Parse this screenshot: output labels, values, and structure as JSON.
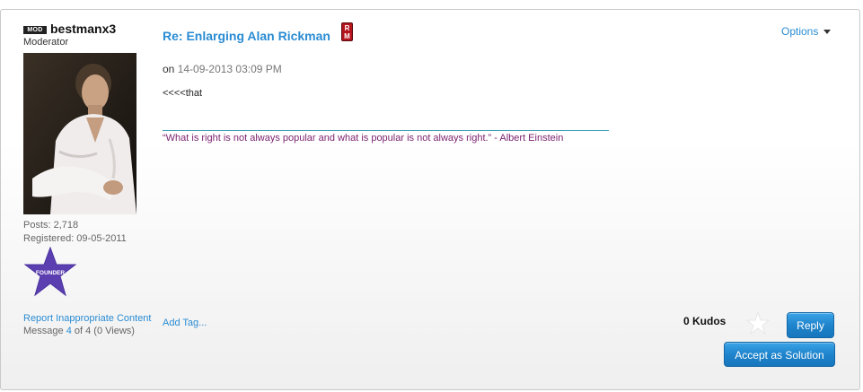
{
  "author": {
    "badge": "MOD",
    "username": "bestmanx3",
    "rank": "Moderator",
    "posts": "Posts: 2,718",
    "registered": "Registered: 09-05-2011",
    "founder_badge": "FOUNDER",
    "founder_badge_color": "#5b3fb0"
  },
  "post": {
    "subject": "Re: Enlarging Alan Rickman",
    "subject_icon_text_top": "R",
    "subject_icon_text_bottom": "M",
    "options_label": "Options",
    "date_prefix": "on",
    "date": "14-09-2013 03:09 PM",
    "body": "<<<<that",
    "signature": "“What is right is not always popular and what is popular is not always right.” - Albert Einstein",
    "add_tag": "Add Tag..."
  },
  "footer": {
    "report_link": "Report Inappropriate Content",
    "message_label": "Message",
    "message_number": "4",
    "message_of": "of 4 (0 Views)",
    "kudos": "0 Kudos",
    "reply_label": "Reply",
    "accept_label": "Accept as Solution"
  },
  "colors": {
    "link_blue": "#2a8cd3",
    "button_blue": "#1f84cc",
    "signature_purple": "#7a1f6e",
    "rm_icon_red": "#b5141d"
  }
}
